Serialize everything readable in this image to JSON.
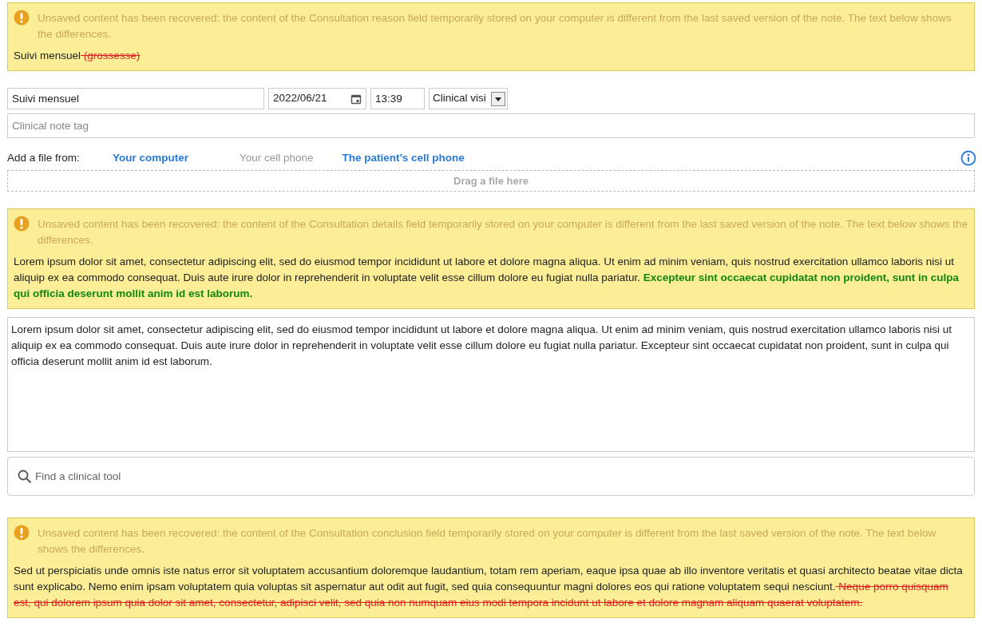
{
  "reason_recovery": {
    "message": "Unsaved content has been recovered: the content of the Consultation reason field temporarily stored on your computer is different from the last saved version of the note. The text below shows the differences.",
    "diff": [
      {
        "kind": "same",
        "text": "Suivi mensuel"
      },
      {
        "kind": "removed",
        "text": " (grossesse)"
      }
    ]
  },
  "note_header": {
    "title": "Suivi mensuel",
    "date": "2022/06/21",
    "time": "13:39",
    "type": "Clinical visi",
    "tag_placeholder": "Clinical note tag"
  },
  "attachments": {
    "label": "Add a file from:",
    "sources": [
      {
        "label": "Your computer",
        "disabled": false
      },
      {
        "label": "Your cell phone",
        "disabled": true
      },
      {
        "label": "The patient’s cell phone",
        "disabled": false
      }
    ],
    "drop_zone": "Drag a file here"
  },
  "details_recovery": {
    "message": "Unsaved content has been recovered: the content of the Consultation details field temporarily stored on your computer is different from the last saved version of the note. The text below shows the differences.",
    "diff": [
      {
        "kind": "same",
        "text": "Lorem ipsum dolor sit amet, consectetur adipiscing elit, sed do eiusmod tempor incididunt ut labore et dolore magna aliqua. Ut enim ad minim veniam, quis nostrud exercitation ullamco laboris nisi ut aliquip ex ea commodo consequat. Duis aute irure dolor in reprehenderit in voluptate velit esse cillum dolore eu fugiat nulla pariatur."
      },
      {
        "kind": "added",
        "text": " Excepteur sint occaecat cupidatat non proident, sunt in culpa qui officia deserunt mollit anim id est laborum."
      }
    ]
  },
  "details": {
    "value": "Lorem ipsum dolor sit amet, consectetur adipiscing elit, sed do eiusmod tempor incididunt ut labore et dolore magna aliqua. Ut enim ad minim veniam, quis nostrud exercitation ullamco laboris nisi ut aliquip ex ea commodo consequat. Duis aute irure dolor in reprehenderit in voluptate velit esse cillum dolore eu fugiat nulla pariatur. Excepteur sint occaecat cupidatat non proident, sunt in culpa qui officia deserunt mollit anim id est laborum."
  },
  "tool_search": {
    "placeholder": "Find a clinical tool"
  },
  "conclusion_recovery": {
    "message": "Unsaved content has been recovered: the content of the Consultation conclusion field temporarily stored on your computer is different from the last saved version of the note. The text below shows the differences.",
    "diff": [
      {
        "kind": "same",
        "text": "Sed ut perspiciatis unde omnis iste natus error sit voluptatem accusantium doloremque laudantium, totam rem aperiam, eaque ipsa quae ab illo inventore veritatis et quasi architecto beatae vitae dicta sunt explicabo. Nemo enim ipsam voluptatem quia voluptas sit aspernatur aut odit aut fugit, sed quia consequuntur magni dolores eos qui ratione voluptatem sequi nesciunt."
      },
      {
        "kind": "removed",
        "text": " Neque porro quisquam est, qui dolorem ipsum quia dolor sit amet, consectetur, adipisci velit, sed quia non numquam eius modi tempora incidunt ut labore et dolore magnam aliquam quaerat voluptatem."
      }
    ]
  }
}
